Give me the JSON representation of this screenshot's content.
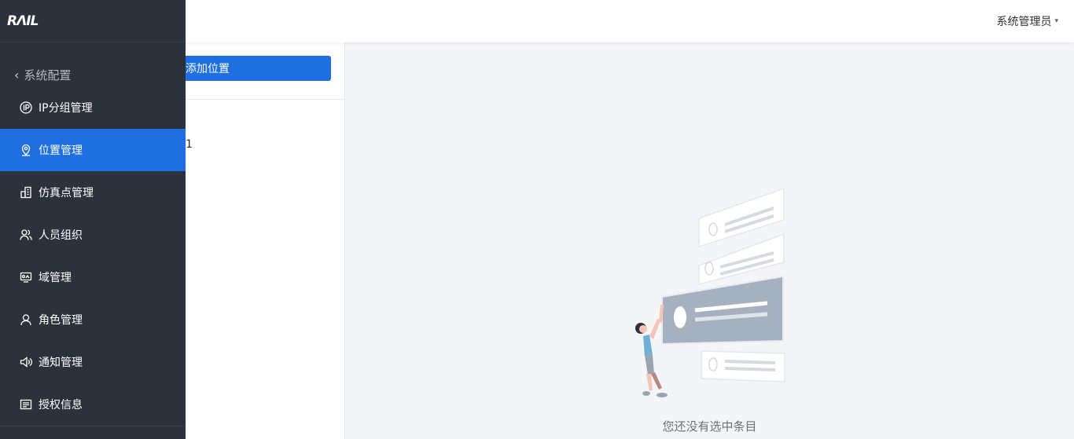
{
  "brand": {
    "logo_text": "RΛIL"
  },
  "header": {
    "user_name": "系统管理员"
  },
  "sidebar": {
    "back_label": "系统配置",
    "items": [
      {
        "label": "IP分组管理",
        "icon": "ip-icon",
        "active": false
      },
      {
        "label": "位置管理",
        "icon": "location-icon",
        "active": true
      },
      {
        "label": "仿真点管理",
        "icon": "building-icon",
        "active": false
      },
      {
        "label": "人员组织",
        "icon": "users-icon",
        "active": false
      },
      {
        "label": "域管理",
        "icon": "domain-icon",
        "active": false
      },
      {
        "label": "角色管理",
        "icon": "user-icon",
        "active": false
      },
      {
        "label": "通知管理",
        "icon": "speaker-icon",
        "active": false
      },
      {
        "label": "授权信息",
        "icon": "license-icon",
        "active": false
      }
    ]
  },
  "location_panel": {
    "add_button_label": "添加位置",
    "tree_node_label": "1"
  },
  "detail": {
    "empty_message": "您还没有选中条目"
  },
  "colors": {
    "accent": "#1f6fe0",
    "sidebar_bg": "#2c323c",
    "content_bg": "#f4f5f7"
  }
}
